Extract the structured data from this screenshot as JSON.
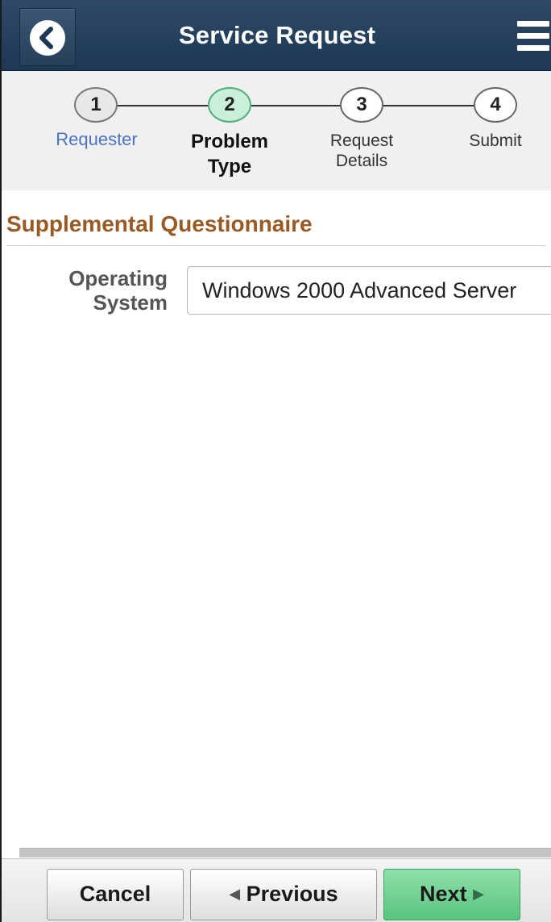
{
  "header": {
    "title": "Service Request",
    "back_icon": "chevron-left-icon",
    "menu_icon": "hamburger-menu-icon"
  },
  "train": {
    "steps": [
      {
        "number": "1",
        "label": "Requester",
        "state": "completed"
      },
      {
        "number": "2",
        "label_line1": "Problem",
        "label_line2": "Type",
        "state": "current"
      },
      {
        "number": "3",
        "label_line1": "Request",
        "label_line2": "Details",
        "state": "pending"
      },
      {
        "number": "4",
        "label": "Submit",
        "state": "pending"
      }
    ]
  },
  "main": {
    "section_title": "Supplemental Questionnaire",
    "fields": [
      {
        "label_line1": "Operating",
        "label_line2": "System",
        "value": "Windows 2000 Advanced Server"
      }
    ]
  },
  "footer": {
    "cancel_label": "Cancel",
    "previous_label": "Previous",
    "next_label": "Next"
  },
  "colors": {
    "header_bg": "#1d3854",
    "section_title": "#9a5a24",
    "active_step": "#c9eed9",
    "link": "#4b72c4",
    "next_button": "#58c47f"
  }
}
